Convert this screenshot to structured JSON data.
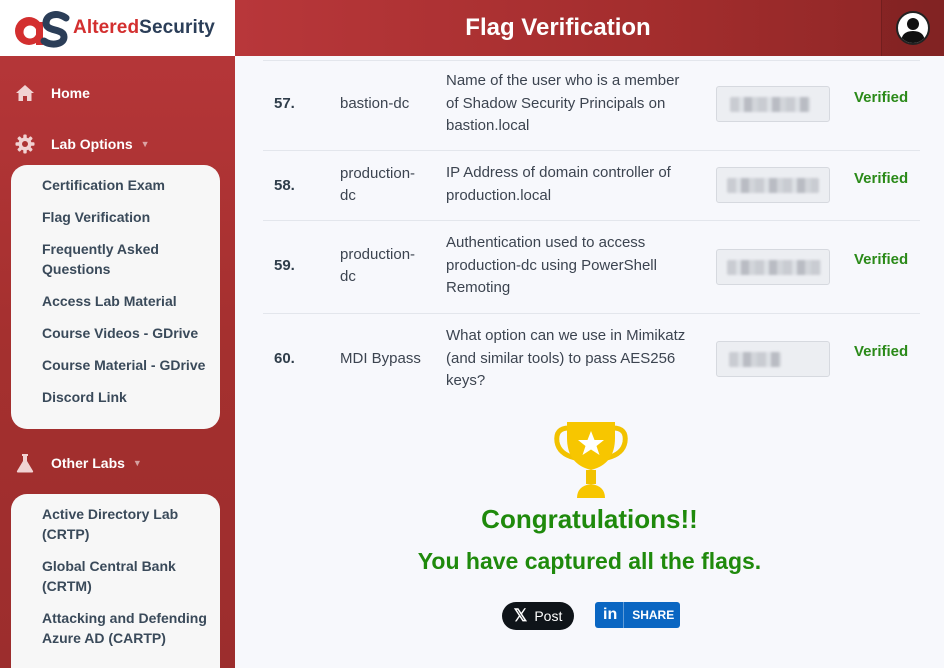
{
  "brand": {
    "altered": "Altered",
    "security": "Security"
  },
  "header": {
    "title": "Flag Verification"
  },
  "sidebar": {
    "home": "Home",
    "lab_options": "Lab Options",
    "lab_options_items": [
      "Certification Exam",
      "Flag Verification",
      "Frequently Asked Questions",
      "Access Lab Material",
      "Course Videos - GDrive",
      "Course Material - GDrive",
      "Discord Link"
    ],
    "other_labs": "Other Labs",
    "other_labs_items": [
      "Active Directory Lab (CRTP)",
      "Global Central Bank (CRTM)",
      "Attacking and Defending Azure AD (CARTP)"
    ]
  },
  "flags": [
    {
      "num": "57.",
      "host": "bastion-dc",
      "question": "Name of the user who is a member of Shadow Security Principals on bastion.local",
      "status": "Verified"
    },
    {
      "num": "58.",
      "host": "production-dc",
      "question": "IP Address of domain controller of production.local",
      "status": "Verified"
    },
    {
      "num": "59.",
      "host": "production-dc",
      "question": "Authentication used to access production-dc using PowerShell Remoting",
      "status": "Verified"
    },
    {
      "num": "60.",
      "host": "MDI Bypass",
      "question": "What option can we use in Mimikatz (and similar tools) to pass AES256 keys?",
      "status": "Verified"
    }
  ],
  "result": {
    "congrats": "Congratulations!!",
    "message": "You have captured all the flags."
  },
  "share": {
    "x_label": "Post",
    "linkedin_label": "SHARE"
  },
  "colors": {
    "brand_red": "#b8373a",
    "success_green": "#1f8a0c",
    "linkedin_blue": "#0a66c2"
  }
}
